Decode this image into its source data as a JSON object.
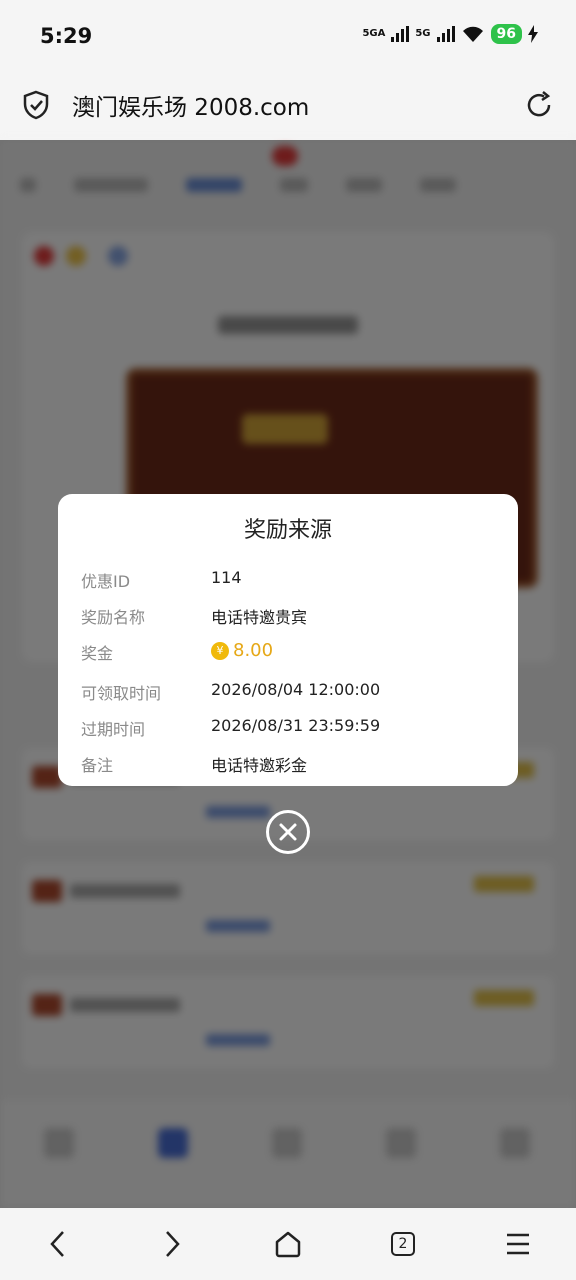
{
  "status_bar": {
    "time": "5:29",
    "network_1": "5GA",
    "network_2": "5G",
    "battery": "96"
  },
  "address_bar": {
    "url_text": "澳门娱乐场 2008.com",
    "security_icon": "shield-check-icon",
    "reload_icon": "reload-icon"
  },
  "modal": {
    "title": "奖励来源",
    "rows": [
      {
        "label": "优惠ID",
        "value": "114"
      },
      {
        "label": "奖励名称",
        "value": "电话特邀贵宾"
      },
      {
        "label": "奖金",
        "value": "8.00",
        "coin_symbol": "¥"
      },
      {
        "label": "可领取时间",
        "value": "2026/08/04 12:00:00"
      },
      {
        "label": "过期时间",
        "value": "2026/08/31 23:59:59"
      },
      {
        "label": "备注",
        "value": "电话特邀彩金"
      }
    ],
    "amount_color": "#e6a817"
  },
  "browser_nav": {
    "tab_count": "2",
    "icons": [
      "back-icon",
      "forward-icon",
      "home-icon",
      "tabs-icon",
      "menu-icon"
    ]
  },
  "colors": {
    "battery": "#2ec24a",
    "overlay": "rgba(0,0,0,0.52)",
    "coin": "#f0b90b"
  }
}
